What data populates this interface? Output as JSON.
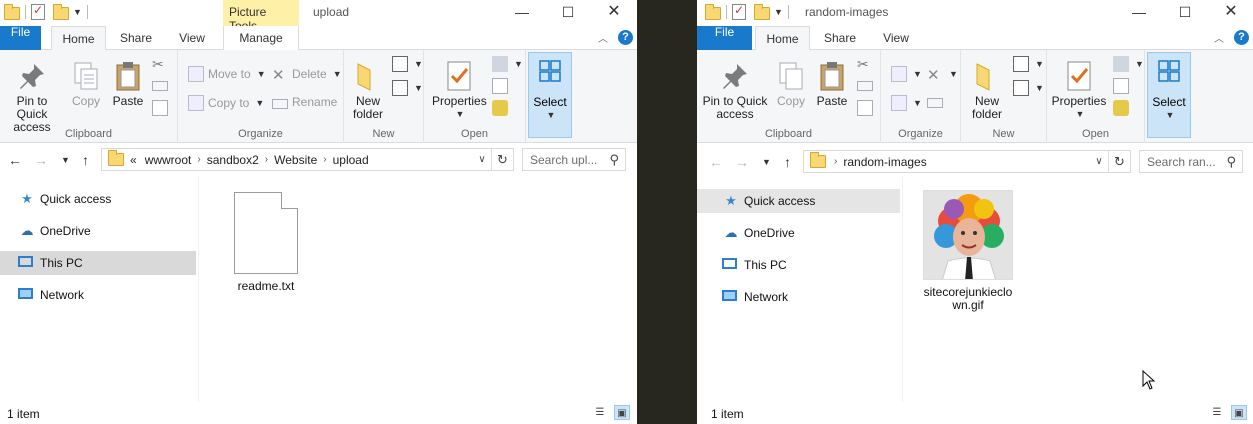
{
  "left": {
    "title": "upload",
    "context_tab": "Picture Tools",
    "tabs": {
      "file": "File",
      "home": "Home",
      "share": "Share",
      "view": "View",
      "manage": "Manage"
    },
    "ribbon": {
      "clipboard": {
        "label": "Clipboard",
        "pin": "Pin to Quick access",
        "copy": "Copy",
        "paste": "Paste"
      },
      "organize": {
        "label": "Organize",
        "move_to": "Move to",
        "copy_to": "Copy to",
        "delete": "Delete",
        "rename": "Rename"
      },
      "new": {
        "label": "New",
        "new_folder": "New folder"
      },
      "open": {
        "label": "Open",
        "properties": "Properties"
      },
      "select": {
        "label": "Select"
      }
    },
    "address": {
      "prefix": "«",
      "crumbs": [
        "wwwroot",
        "sandbox2",
        "Website",
        "upload"
      ]
    },
    "search_placeholder": "Search upl...",
    "nav": [
      "Quick access",
      "OneDrive",
      "This PC",
      "Network"
    ],
    "files": [
      {
        "name": "readme.txt",
        "kind": "text"
      }
    ],
    "status": "1 item"
  },
  "right": {
    "title": "random-images",
    "tabs": {
      "file": "File",
      "home": "Home",
      "share": "Share",
      "view": "View"
    },
    "ribbon": {
      "clipboard": {
        "label": "Clipboard",
        "pin": "Pin to Quick access",
        "copy": "Copy",
        "paste": "Paste"
      },
      "organize": {
        "label": "Organize"
      },
      "new": {
        "label": "New",
        "new_folder": "New folder"
      },
      "open": {
        "label": "Open",
        "properties": "Properties"
      },
      "select": {
        "label": "Select"
      }
    },
    "address": {
      "crumbs": [
        "random-images"
      ]
    },
    "search_placeholder": "Search ran...",
    "nav": [
      "Quick access",
      "OneDrive",
      "This PC",
      "Network"
    ],
    "files": [
      {
        "name_line1": "sitecorejunkieclo",
        "name_line2": "wn.gif",
        "kind": "image"
      }
    ],
    "status": "1 item"
  },
  "colors": {
    "file_tab": "#1979ca",
    "context_tab": "#fef0a6",
    "selection": "#cce4f7",
    "nav_selected": "#d9d9d9",
    "folder": "#f8d775"
  }
}
